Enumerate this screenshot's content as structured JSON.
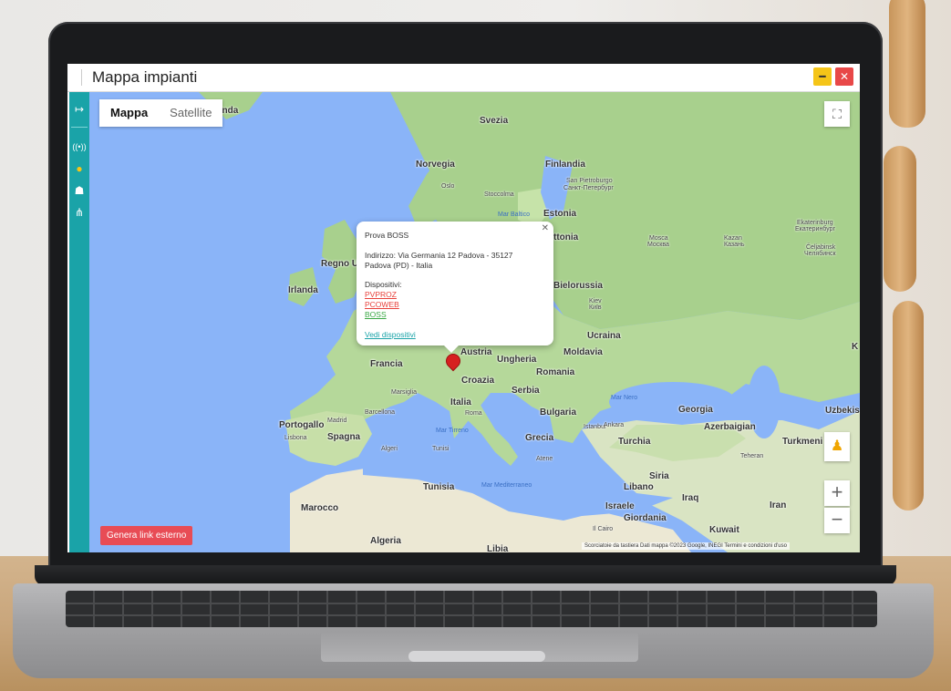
{
  "window": {
    "title": "Mappa impianti"
  },
  "sidebar": {
    "items": [
      {
        "name": "logout",
        "icon": "sign-out-icon"
      },
      {
        "name": "signal",
        "icon": "broadcast-icon"
      },
      {
        "name": "map",
        "icon": "map-pin-icon"
      },
      {
        "name": "home",
        "icon": "house-icon"
      },
      {
        "name": "router",
        "icon": "router-icon"
      }
    ]
  },
  "map": {
    "type_control": {
      "map_label": "Mappa",
      "satellite_label": "Satellite"
    },
    "button": {
      "generate_link": "Genera link esterno"
    },
    "attribution": "Scorciatoie da tastiera   Dati mappa ©2023 Google, INEGI   Termini e condizioni d'uso",
    "labels": {
      "svezia": "Svezia",
      "norvegia": "Norvegia",
      "finlandia": "Finlandia",
      "oslo": "Oslo",
      "stoccolma": "Stoccolma",
      "sanpietro": "San Pietroburgo",
      "sanpietro_ru": "Санкт-Петербург",
      "estonia": "Estonia",
      "lettonia": "ttonia",
      "regno": "Regno U",
      "irlanda": "Irlanda",
      "bielorussia": "Bielorussia",
      "ucraina": "Ucraina",
      "mosca": "Mosca",
      "mosca_ru": "Москва",
      "kazan": "Kazan",
      "kazan_ru": "Казань",
      "ekat": "Ekaterinburg",
      "ekat_ru": "Екатеринбург",
      "celj": "Čeljabinsk",
      "celj_ru": "Челябинск",
      "kiev": "Kiev",
      "kiev_ru": "Київ",
      "francia": "Francia",
      "austria": "Austria",
      "ungheria": "Ungheria",
      "moldavia": "Moldavia",
      "romania": "Romania",
      "croazia": "Croazia",
      "serbia": "Serbia",
      "italia": "Italia",
      "roma": "Roma",
      "bulgaria": "Bulgaria",
      "marsiglia": "Marsiglia",
      "barcellona": "Barcellona",
      "madrid": "Madrid",
      "portogallo": "Portogallo",
      "spagna": "Spagna",
      "lisbona": "Lisbona",
      "algeri": "Algeri",
      "tunisi": "Tunisi",
      "tunisia": "Tunisia",
      "marocco": "Marocco",
      "algeria": "Algeria",
      "libia": "Libia",
      "grecia": "Grecia",
      "atene": "Atene",
      "turchia": "Turchia",
      "ankara": "Ankara",
      "istanbul": "Istanbul",
      "georgia": "Georgia",
      "azerbaigian": "Azerbaigian",
      "uzbek": "Uzbekis",
      "turkmeni": "Turkmeni",
      "teheran": "Teheran",
      "siria": "Siria",
      "libano": "Libano",
      "iraq": "Iraq",
      "iran": "Iran",
      "israele": "Israele",
      "giordania": "Giordania",
      "kuwait": "Kuwait",
      "cairo": "Il Cairo",
      "marnero": "Mar Nero",
      "martirreno": "Mar Tirreno",
      "marmed": "Mar Mediterraneo",
      "marbaltico": "Mar Baltico",
      "finlandia_top": "anda",
      "k": "K",
      "ia": "ia",
      "t": "T"
    }
  },
  "popup": {
    "title": "Prova BOSS",
    "address_line1": "Indirizzo: Via Germania 12 Padova - 35127",
    "address_line2": "Padova (PD) - Italia",
    "devices_label": "Dispositivi:",
    "devices": [
      {
        "name": "PVPROZ",
        "color": "#e8413b"
      },
      {
        "name": "PCOWEB",
        "color": "#e8413b"
      },
      {
        "name": "BOSS",
        "color": "#3aa845"
      }
    ],
    "link": "Vedi dispositivi",
    "link_color": "#1aa3a8"
  },
  "colors": {
    "accent": "#1aa3a8",
    "danger": "#e84c55",
    "warning": "#f5c518"
  }
}
